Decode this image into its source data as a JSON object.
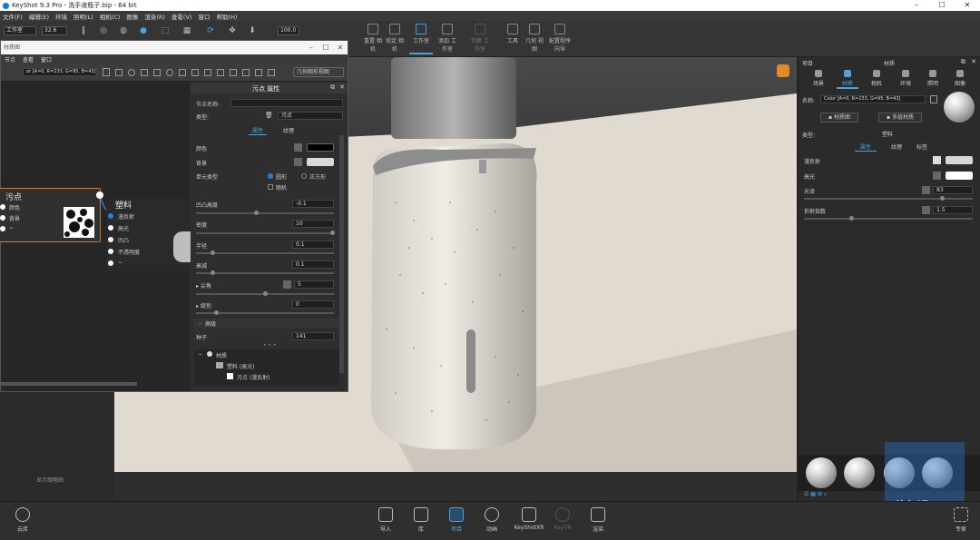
{
  "window": {
    "title": "KeyShot 9.3 Pro - 洗手液瓶子.bip - 64 bit"
  },
  "menu": [
    "文件(F)",
    "编辑(E)",
    "环境",
    "照明(L)",
    "相机(C)",
    "图像",
    "渲染(R)",
    "查看(V)",
    "窗口",
    "帮助(H)"
  ],
  "ribbon": {
    "workspace_label": "工作室",
    "cpu_value": "32.6",
    "zoom_value": "100.0",
    "buttons": [
      {
        "label": "重置 相机",
        "icon": "camera-reset-icon"
      },
      {
        "label": "锁定 相机",
        "icon": "camera-lock-icon"
      },
      {
        "label": "工作室",
        "icon": "studio-icon"
      },
      {
        "label": "添加 工作室",
        "icon": "add-studio-icon"
      },
      {
        "label": "切换 工作室",
        "icon": "switch-studio-icon"
      },
      {
        "label": "工具",
        "icon": "tools-icon"
      },
      {
        "label": "几何 视图",
        "icon": "geometry-view-icon"
      },
      {
        "label": "配置程序 向导",
        "icon": "configurator-icon"
      }
    ]
  },
  "material_graph": {
    "title": "材质图",
    "menu": [
      "节点",
      "查看",
      "窗口"
    ],
    "geometry_view_label": "几何图形视图",
    "color_field": "or [A=0, R=233, G=95, B=43]",
    "nodes": {
      "spot": {
        "title": "污点",
        "inputs": [
          "颜色",
          "背景",
          "~"
        ]
      },
      "plastic": {
        "title": "塑料",
        "inputs": [
          "漫反射",
          "高光",
          "凹凸",
          "不透明度",
          "~"
        ]
      }
    },
    "bottom_label": "显示缩略图"
  },
  "properties": {
    "header": "污点 属性",
    "node_name_label": "节点名称:",
    "node_name_value": "",
    "type_label": "类型:",
    "type_value": "污点",
    "tabs": [
      "属性",
      "纹理"
    ],
    "fields": [
      {
        "label": "颜色"
      },
      {
        "label": "背景"
      },
      {
        "label": "单元类型"
      },
      {
        "label": "凹凸高度",
        "value": "-0.1"
      },
      {
        "label": "密度",
        "value": "10"
      },
      {
        "label": "半径",
        "value": "0.1"
      },
      {
        "label": "衰减",
        "value": "0.1"
      },
      {
        "label": "尖角",
        "value": "5"
      },
      {
        "label": "级别",
        "value": "0"
      },
      {
        "label": "种子",
        "value": "141"
      }
    ],
    "cell_options": [
      "圆形",
      "正方形",
      "随机"
    ],
    "advanced_label": "高级",
    "tree": [
      "材质",
      "塑料 (高光)",
      "污点 (漫反射)"
    ]
  },
  "right_panel": {
    "project_label": "项目",
    "material_label": "材质",
    "tabs": [
      "场景",
      "材质",
      "相机",
      "环境",
      "照明",
      "图像"
    ],
    "name_label": "名称:",
    "name_value": "Color [A=0, R=233, G=95, B=43]",
    "material_graph_button": "材质图",
    "multi_material_button": "多层材质",
    "type_label": "类型:",
    "type_value": "塑料",
    "subtabs": [
      "属性",
      "纹理",
      "标签"
    ],
    "props": [
      {
        "label": "漫反射"
      },
      {
        "label": "高光"
      },
      {
        "label": "光泽",
        "value": "83"
      },
      {
        "label": "折射指数",
        "value": "1.5"
      }
    ]
  },
  "bottom_bar": {
    "cloud_label": "云库",
    "buttons": [
      {
        "label": "导入",
        "icon": "import-icon"
      },
      {
        "label": "库",
        "icon": "library-icon"
      },
      {
        "label": "项目",
        "icon": "project-icon"
      },
      {
        "label": "动画",
        "icon": "animation-icon"
      },
      {
        "label": "KeyShotXR",
        "icon": "keyshotxr-icon"
      },
      {
        "label": "KeyVR",
        "icon": "keyvr-icon"
      },
      {
        "label": "渲染",
        "icon": "render-icon"
      }
    ],
    "expert_label": "专家"
  },
  "watermark": "草尔课"
}
